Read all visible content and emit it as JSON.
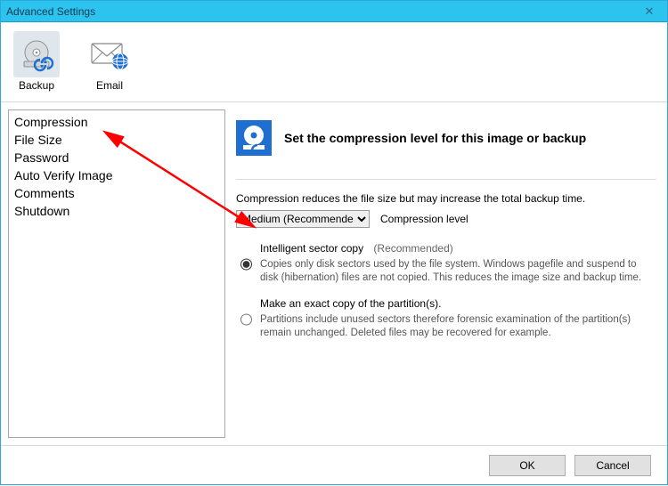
{
  "window": {
    "title": "Advanced Settings",
    "close_symbol": "✕"
  },
  "toolbar": {
    "backup": "Backup",
    "email": "Email"
  },
  "sidebar": {
    "items": [
      {
        "label": "Compression"
      },
      {
        "label": "File Size"
      },
      {
        "label": "Password"
      },
      {
        "label": "Auto Verify Image"
      },
      {
        "label": "Comments"
      },
      {
        "label": "Shutdown"
      }
    ]
  },
  "main": {
    "heading": "Set the compression level for this image or backup",
    "description": "Compression reduces the file size but may increase the total backup time.",
    "combo_value": "Medium (Recommended)",
    "combo_label": "Compression level",
    "radios": {
      "intelligent": {
        "label": "Intelligent sector copy",
        "rec": "(Recommended)",
        "desc": "Copies only disk sectors used by the file system.\nWindows pagefile and suspend to disk (hibernation) files are not copied. This reduces the image size and backup time."
      },
      "exact": {
        "label": "Make an exact copy of the partition(s).",
        "desc": "Partitions include unused sectors therefore forensic examination of the partition(s) remain unchanged. Deleted files may be recovered for example."
      }
    }
  },
  "footer": {
    "ok": "OK",
    "cancel": "Cancel"
  },
  "colors": {
    "titlebar": "#2dc3ef",
    "accent": "#1f6fd0",
    "arrow": "#ff0000"
  }
}
